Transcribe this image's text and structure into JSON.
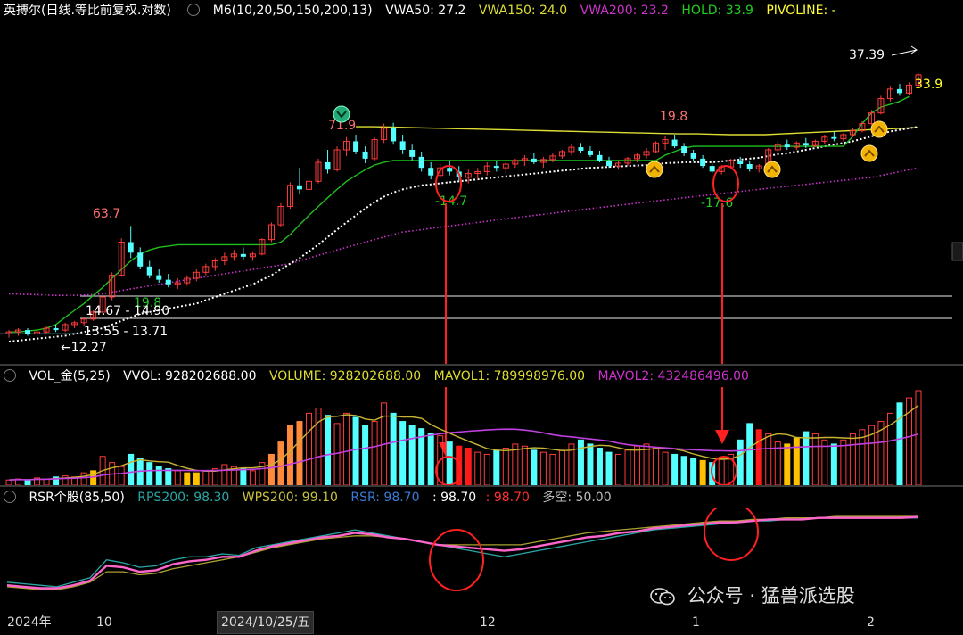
{
  "main_header": {
    "stock": "英搏尔(日线.等比前复权.对数)",
    "ma": "M6(10,20,50,150,200,13)",
    "vwa50": "VWA50: 27.2",
    "vwa150": "VWA150: 24.0",
    "vwa200": "VWA200: 23.2",
    "hold": "HOLD: 33.9",
    "pivoline": "PIVOLINE: -"
  },
  "vol_header": {
    "name": "VOL_金(5,25)",
    "vvol": "VVOL: 928202688.00",
    "volume": "VOLUME: 928202688.00",
    "mavol1": "MAVOL1: 789998976.00",
    "mavol2": "MAVOL2: 432486496.00"
  },
  "rsr_header": {
    "name": "RSR个股(85,50)",
    "rps200": "RPS200: 98.30",
    "wps200": "WPS200: 99.10",
    "rsr": "RSR: 98.70",
    "v1": ": 98.70",
    "v2": ": 98.70",
    "duokong": "多空: 50.00"
  },
  "xaxis": {
    "t1": "2024年",
    "t2": "10",
    "t3": "2024/10/25/五",
    "t4": "12",
    "t5": "1",
    "t6": "2"
  },
  "watermark": "公众号 · 猛兽派选股",
  "colors": {
    "up": "#ff3b3b",
    "down": "#54ffff",
    "ma_hold": "#1fbf1f",
    "vwa50": "#ffffff",
    "vwa150": "#dddd33",
    "vwa200": "#cc33cc",
    "mavol1": "#c8b432",
    "mavol2": "#c040e0",
    "vol_orange": "#ff8a3c",
    "vol_yellow": "#ffc000",
    "rps": "#2aa6a6",
    "wps": "#a8a030",
    "rsr": "#ff66cc",
    "annot": "#ff2020"
  },
  "chart_data": [
    {
      "type": "candlestick",
      "scale": "log",
      "ylim": [
        11.5,
        42
      ],
      "price_labels": [
        "63.7",
        "19.8",
        "14.67 - 14.90",
        "13.55 - 13.71",
        "12.27",
        "71.9",
        "19.8",
        "-14.7",
        "-17.6",
        "37.39",
        "33.9"
      ],
      "ohlc": [
        [
          12.3,
          12.5,
          12.1,
          12.4
        ],
        [
          12.4,
          12.6,
          12.2,
          12.5
        ],
        [
          12.5,
          12.6,
          12.2,
          12.3
        ],
        [
          12.3,
          12.5,
          12.1,
          12.4
        ],
        [
          12.4,
          12.7,
          12.3,
          12.6
        ],
        [
          12.6,
          12.8,
          12.4,
          12.5
        ],
        [
          12.5,
          12.9,
          12.4,
          12.8
        ],
        [
          12.8,
          13.0,
          12.6,
          12.9
        ],
        [
          12.9,
          13.2,
          12.7,
          13.1
        ],
        [
          13.1,
          13.6,
          13.0,
          13.5
        ],
        [
          13.5,
          14.5,
          13.4,
          14.4
        ],
        [
          14.4,
          16.0,
          14.2,
          15.8
        ],
        [
          15.8,
          18.5,
          15.7,
          18.2
        ],
        [
          18.2,
          19.5,
          17.0,
          17.4
        ],
        [
          17.4,
          17.8,
          16.2,
          16.4
        ],
        [
          16.4,
          16.8,
          15.6,
          15.8
        ],
        [
          15.8,
          16.2,
          15.3,
          15.5
        ],
        [
          15.5,
          15.9,
          15.0,
          15.2
        ],
        [
          15.2,
          15.6,
          14.9,
          15.3
        ],
        [
          15.3,
          15.8,
          15.1,
          15.6
        ],
        [
          15.6,
          16.2,
          15.4,
          16.0
        ],
        [
          16.0,
          16.6,
          15.8,
          16.4
        ],
        [
          16.4,
          17.0,
          16.1,
          16.8
        ],
        [
          16.8,
          17.4,
          16.5,
          17.1
        ],
        [
          17.1,
          17.6,
          16.8,
          17.3
        ],
        [
          17.3,
          17.8,
          16.9,
          17.1
        ],
        [
          17.1,
          17.5,
          16.8,
          17.3
        ],
        [
          17.3,
          18.5,
          17.2,
          18.4
        ],
        [
          18.4,
          19.8,
          18.2,
          19.6
        ],
        [
          19.6,
          21.5,
          19.4,
          21.2
        ],
        [
          21.2,
          23.5,
          21.0,
          23.2
        ],
        [
          23.2,
          25.0,
          22.4,
          22.8
        ],
        [
          22.8,
          24.0,
          21.6,
          23.6
        ],
        [
          23.6,
          26.0,
          23.4,
          25.6
        ],
        [
          25.6,
          27.0,
          24.4,
          24.8
        ],
        [
          24.8,
          27.4,
          24.6,
          27.0
        ],
        [
          27.0,
          28.5,
          26.3,
          28.0
        ],
        [
          28.0,
          28.8,
          26.5,
          26.8
        ],
        [
          26.8,
          27.4,
          25.5,
          26.0
        ],
        [
          26.0,
          28.5,
          25.8,
          28.2
        ],
        [
          28.2,
          30.2,
          27.8,
          29.6
        ],
        [
          29.6,
          30.3,
          27.6,
          28.0
        ],
        [
          28.0,
          28.8,
          26.5,
          27.0
        ],
        [
          27.0,
          27.6,
          25.8,
          26.2
        ],
        [
          26.2,
          26.8,
          24.6,
          25.0
        ],
        [
          25.0,
          25.6,
          23.8,
          24.2
        ],
        [
          24.2,
          25.4,
          23.9,
          25.0
        ],
        [
          25.0,
          25.8,
          24.2,
          24.6
        ],
        [
          24.6,
          25.2,
          23.6,
          24.0
        ],
        [
          24.0,
          24.8,
          23.4,
          24.4
        ],
        [
          24.4,
          25.0,
          23.8,
          24.6
        ],
        [
          24.6,
          25.6,
          24.2,
          25.2
        ],
        [
          25.2,
          25.8,
          24.6,
          25.0
        ],
        [
          25.0,
          25.6,
          24.4,
          25.4
        ],
        [
          25.4,
          26.0,
          25.0,
          25.8
        ],
        [
          25.8,
          26.4,
          25.2,
          26.0
        ],
        [
          26.0,
          26.6,
          25.4,
          25.6
        ],
        [
          25.6,
          26.2,
          25.0,
          25.9
        ],
        [
          25.9,
          26.6,
          25.6,
          26.3
        ],
        [
          26.3,
          27.0,
          26.0,
          26.8
        ],
        [
          26.8,
          27.6,
          26.4,
          27.3
        ],
        [
          27.3,
          27.8,
          26.6,
          26.9
        ],
        [
          26.9,
          27.4,
          26.2,
          26.4
        ],
        [
          26.4,
          26.9,
          25.6,
          25.8
        ],
        [
          25.8,
          26.2,
          25.0,
          25.2
        ],
        [
          25.2,
          25.8,
          24.8,
          25.5
        ],
        [
          25.5,
          26.2,
          25.2,
          26.0
        ],
        [
          26.0,
          26.6,
          25.6,
          26.4
        ],
        [
          26.4,
          27.2,
          26.0,
          26.8
        ],
        [
          26.8,
          28.0,
          26.6,
          27.8
        ],
        [
          27.8,
          28.6,
          27.0,
          28.2
        ],
        [
          28.2,
          28.8,
          27.2,
          27.4
        ],
        [
          27.4,
          27.8,
          26.3,
          26.6
        ],
        [
          26.6,
          27.0,
          25.8,
          26.0
        ],
        [
          26.0,
          26.4,
          25.0,
          25.2
        ],
        [
          25.2,
          25.6,
          24.4,
          24.6
        ],
        [
          24.6,
          25.3,
          24.3,
          25.1
        ],
        [
          25.1,
          26.0,
          24.9,
          25.8
        ],
        [
          25.8,
          26.2,
          25.0,
          25.4
        ],
        [
          25.4,
          25.8,
          24.6,
          24.9
        ],
        [
          24.9,
          25.4,
          24.5,
          25.2
        ],
        [
          25.2,
          27.2,
          25.0,
          27.0
        ],
        [
          27.0,
          28.0,
          26.6,
          27.6
        ],
        [
          27.6,
          28.2,
          27.0,
          27.3
        ],
        [
          27.3,
          28.0,
          27.0,
          27.8
        ],
        [
          27.8,
          28.4,
          27.2,
          27.5
        ],
        [
          27.5,
          28.2,
          27.3,
          28.0
        ],
        [
          28.0,
          28.8,
          27.7,
          28.5
        ],
        [
          28.5,
          29.2,
          28.0,
          28.3
        ],
        [
          28.3,
          29.0,
          28.0,
          28.8
        ],
        [
          28.8,
          29.6,
          28.5,
          29.3
        ],
        [
          29.3,
          30.5,
          29.1,
          30.2
        ],
        [
          30.2,
          32.0,
          30.0,
          31.6
        ],
        [
          31.6,
          34.0,
          31.4,
          33.6
        ],
        [
          33.6,
          35.5,
          33.2,
          35.0
        ],
        [
          35.0,
          35.8,
          34.0,
          34.4
        ],
        [
          34.4,
          36.0,
          34.1,
          35.6
        ],
        [
          35.6,
          37.4,
          35.2,
          37.2
        ]
      ],
      "vwa50": [
        11.9,
        11.95,
        12.0,
        12.05,
        12.1,
        12.15,
        12.2,
        12.3,
        12.4,
        12.5,
        12.6,
        12.8,
        13.0,
        13.2,
        13.4,
        13.5,
        13.6,
        13.7,
        13.8,
        13.9,
        14.0,
        14.2,
        14.4,
        14.6,
        14.8,
        15.0,
        15.2,
        15.5,
        15.8,
        16.2,
        16.6,
        17.0,
        17.5,
        18.0,
        18.6,
        19.2,
        19.8,
        20.4,
        21.0,
        21.6,
        22.1,
        22.5,
        22.8,
        23.0,
        23.2,
        23.3,
        23.4,
        23.5,
        23.6,
        23.7,
        23.8,
        23.9,
        24.0,
        24.1,
        24.2,
        24.3,
        24.4,
        24.5,
        24.6,
        24.7,
        24.8,
        24.9,
        25.0,
        25.05,
        25.1,
        25.15,
        25.2,
        25.25,
        25.3,
        25.4,
        25.5,
        25.55,
        25.6,
        25.6,
        25.6,
        25.6,
        25.7,
        25.8,
        25.9,
        26.0,
        26.1,
        26.3,
        26.5,
        26.6,
        26.8,
        27.0,
        27.2,
        27.4,
        27.6,
        27.8,
        28.0,
        28.3,
        28.6,
        28.9,
        29.2,
        29.4,
        29.6,
        29.8
      ],
      "vwa150": [
        29.8,
        29.8,
        29.75,
        29.7,
        29.65,
        29.6,
        29.55,
        29.5,
        29.45,
        29.4,
        29.35,
        29.3,
        29.25,
        29.2,
        29.15,
        29.1,
        29.05,
        29.0,
        28.95,
        28.9,
        28.9,
        28.85,
        28.8,
        28.8,
        28.8,
        28.9,
        29.0,
        29.1,
        29.2,
        29.3,
        29.4,
        29.5,
        29.6,
        29.7
      ],
      "vwa200": [
        14.6,
        14.58,
        14.56,
        14.54,
        14.52,
        14.5,
        14.5,
        14.5,
        14.52,
        14.55,
        14.6,
        14.7,
        14.8,
        14.9,
        15.0,
        15.1,
        15.2,
        15.3,
        15.4,
        15.5,
        15.6,
        15.7,
        15.8,
        15.9,
        16.0,
        16.1,
        16.2,
        16.3,
        16.4,
        16.5,
        16.6,
        16.8,
        17.0,
        17.2,
        17.4,
        17.6,
        17.8,
        18.0,
        18.2,
        18.4,
        18.6,
        18.8,
        19.0,
        19.1,
        19.2,
        19.3,
        19.4,
        19.5,
        19.6,
        19.7,
        19.8,
        19.9,
        20.0,
        20.1,
        20.2,
        20.3,
        20.4,
        20.5,
        20.6,
        20.7,
        20.8,
        20.9,
        21.0,
        21.1,
        21.2,
        21.3,
        21.4,
        21.5,
        21.6,
        21.7,
        21.8,
        21.9,
        22.0,
        22.1,
        22.2,
        22.3,
        22.4,
        22.5,
        22.6,
        22.7,
        22.8,
        22.9,
        23.0,
        23.1,
        23.2,
        23.3,
        23.4,
        23.5,
        23.6,
        23.7,
        23.8,
        23.9,
        24.0,
        24.2,
        24.4,
        24.6,
        24.8,
        25.0
      ],
      "hold": [
        12.4,
        12.4,
        12.45,
        12.5,
        12.6,
        12.8,
        13.2,
        13.6,
        14.0,
        14.5,
        15.0,
        15.6,
        16.2,
        16.8,
        17.3,
        17.6,
        17.8,
        17.9,
        18.0,
        18.0,
        18.0,
        18.0,
        18.0,
        18.0,
        18.0,
        18.0,
        18.0,
        18.0,
        18.0,
        18.2,
        18.8,
        19.6,
        20.4,
        21.2,
        22.0,
        22.8,
        23.6,
        24.2,
        24.8,
        25.3,
        25.6,
        25.8,
        25.8,
        25.8,
        25.8,
        25.8,
        25.8,
        25.8,
        25.8,
        25.8,
        25.8,
        25.8,
        25.8,
        25.8,
        25.8,
        25.8,
        25.8,
        25.8,
        25.8,
        25.8,
        25.8,
        25.8,
        25.8,
        25.8,
        25.8,
        25.8,
        25.8,
        25.8,
        25.8,
        25.8,
        26.4,
        26.8,
        27.2,
        27.4,
        27.4,
        27.4,
        27.4,
        27.4,
        27.4,
        27.4,
        27.4,
        27.4,
        27.4,
        27.4,
        27.4,
        27.4,
        27.4,
        27.4,
        27.4,
        27.4,
        28.6,
        30.2,
        31.6,
        32.4,
        32.8,
        33.2,
        33.9
      ]
    },
    {
      "type": "bar",
      "name": "VOL",
      "ylim": [
        0,
        1400000000
      ],
      "values": [
        5,
        6,
        5,
        7,
        6,
        8,
        9,
        8,
        12,
        14,
        28,
        22,
        18,
        30,
        26,
        22,
        18,
        16,
        14,
        12,
        12,
        14,
        16,
        20,
        18,
        16,
        14,
        22,
        30,
        42,
        58,
        62,
        70,
        75,
        68,
        60,
        70,
        66,
        58,
        62,
        80,
        70,
        62,
        58,
        55,
        50,
        48,
        42,
        38,
        36,
        32,
        30,
        34,
        36,
        40,
        38,
        34,
        32,
        30,
        34,
        40,
        44,
        40,
        36,
        32,
        30,
        34,
        38,
        40,
        36,
        32,
        30,
        28,
        26,
        24,
        22,
        26,
        30,
        44,
        60,
        54,
        50,
        42,
        40,
        46,
        52,
        50,
        44,
        40,
        44,
        50,
        54,
        58,
        62,
        70,
        80,
        85,
        92
      ]
    },
    {
      "type": "line",
      "name": "RSR",
      "ylim": [
        0,
        100
      ],
      "rps200": [
        55,
        54,
        53,
        52,
        55,
        58,
        70,
        68,
        65,
        66,
        70,
        72,
        72,
        74,
        73,
        78,
        80,
        82,
        84,
        86,
        88,
        90,
        88,
        86,
        84,
        82,
        80,
        78,
        76,
        74,
        72,
        74,
        76,
        78,
        80,
        82,
        84,
        86,
        88,
        90,
        91,
        92,
        93,
        94,
        95,
        96,
        96,
        97,
        97,
        98,
        98,
        98,
        98,
        98,
        98,
        98
      ],
      "wps200": [
        52,
        51,
        50,
        50,
        52,
        55,
        62,
        62,
        60,
        61,
        64,
        66,
        68,
        70,
        72,
        75,
        78,
        80,
        82,
        84,
        85,
        86,
        86,
        85,
        84,
        82,
        80,
        80,
        80,
        80,
        80,
        80,
        82,
        84,
        86,
        88,
        89,
        90,
        91,
        92,
        93,
        94,
        95,
        96,
        96,
        97,
        97,
        98,
        98,
        98,
        99,
        99,
        99,
        99,
        99,
        99
      ],
      "rsr": [
        53,
        52,
        51,
        51,
        53,
        56,
        66,
        65,
        62,
        63,
        67,
        69,
        70,
        72,
        72,
        76,
        79,
        81,
        83,
        85,
        86,
        88,
        87,
        85,
        84,
        82,
        80,
        79,
        78,
        77,
        76,
        77,
        79,
        81,
        83,
        85,
        86,
        88,
        89,
        91,
        92,
        93,
        94,
        95,
        95,
        96,
        97,
        97,
        97,
        98,
        98,
        98,
        98,
        98,
        98,
        98.7
      ]
    }
  ]
}
